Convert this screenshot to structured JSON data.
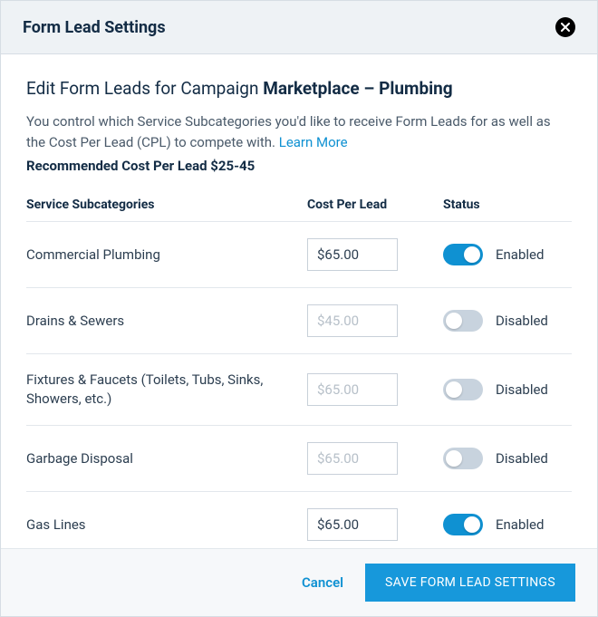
{
  "header": {
    "title": "Form Lead Settings"
  },
  "body": {
    "heading_prefix": "Edit Form Leads for Campaign ",
    "campaign_name": "Marketplace – Plumbing",
    "description": "You control which Service Subcategories you'd like to receive Form Leads for as well as the Cost Per Lead (CPL) to compete with. ",
    "learn_more": "Learn More",
    "recommended": "Recommended Cost Per Lead $25-45"
  },
  "table": {
    "headers": {
      "subcategory": "Service Subcategories",
      "cost": "Cost Per Lead",
      "status": "Status"
    },
    "rows": [
      {
        "name": "Commercial Plumbing",
        "cost": "$65.00",
        "enabled": true,
        "status_label": "Enabled"
      },
      {
        "name": "Drains & Sewers",
        "cost": "$45.00",
        "enabled": false,
        "status_label": "Disabled"
      },
      {
        "name": "Fixtures & Faucets (Toilets, Tubs, Sinks, Showers, etc.)",
        "cost": "$65.00",
        "enabled": false,
        "status_label": "Disabled"
      },
      {
        "name": "Garbage Disposal",
        "cost": "$65.00",
        "enabled": false,
        "status_label": "Disabled"
      },
      {
        "name": "Gas Lines",
        "cost": "$65.00",
        "enabled": true,
        "status_label": "Enabled"
      }
    ]
  },
  "footer": {
    "cancel": "Cancel",
    "save": "SAVE FORM LEAD SETTINGS"
  }
}
